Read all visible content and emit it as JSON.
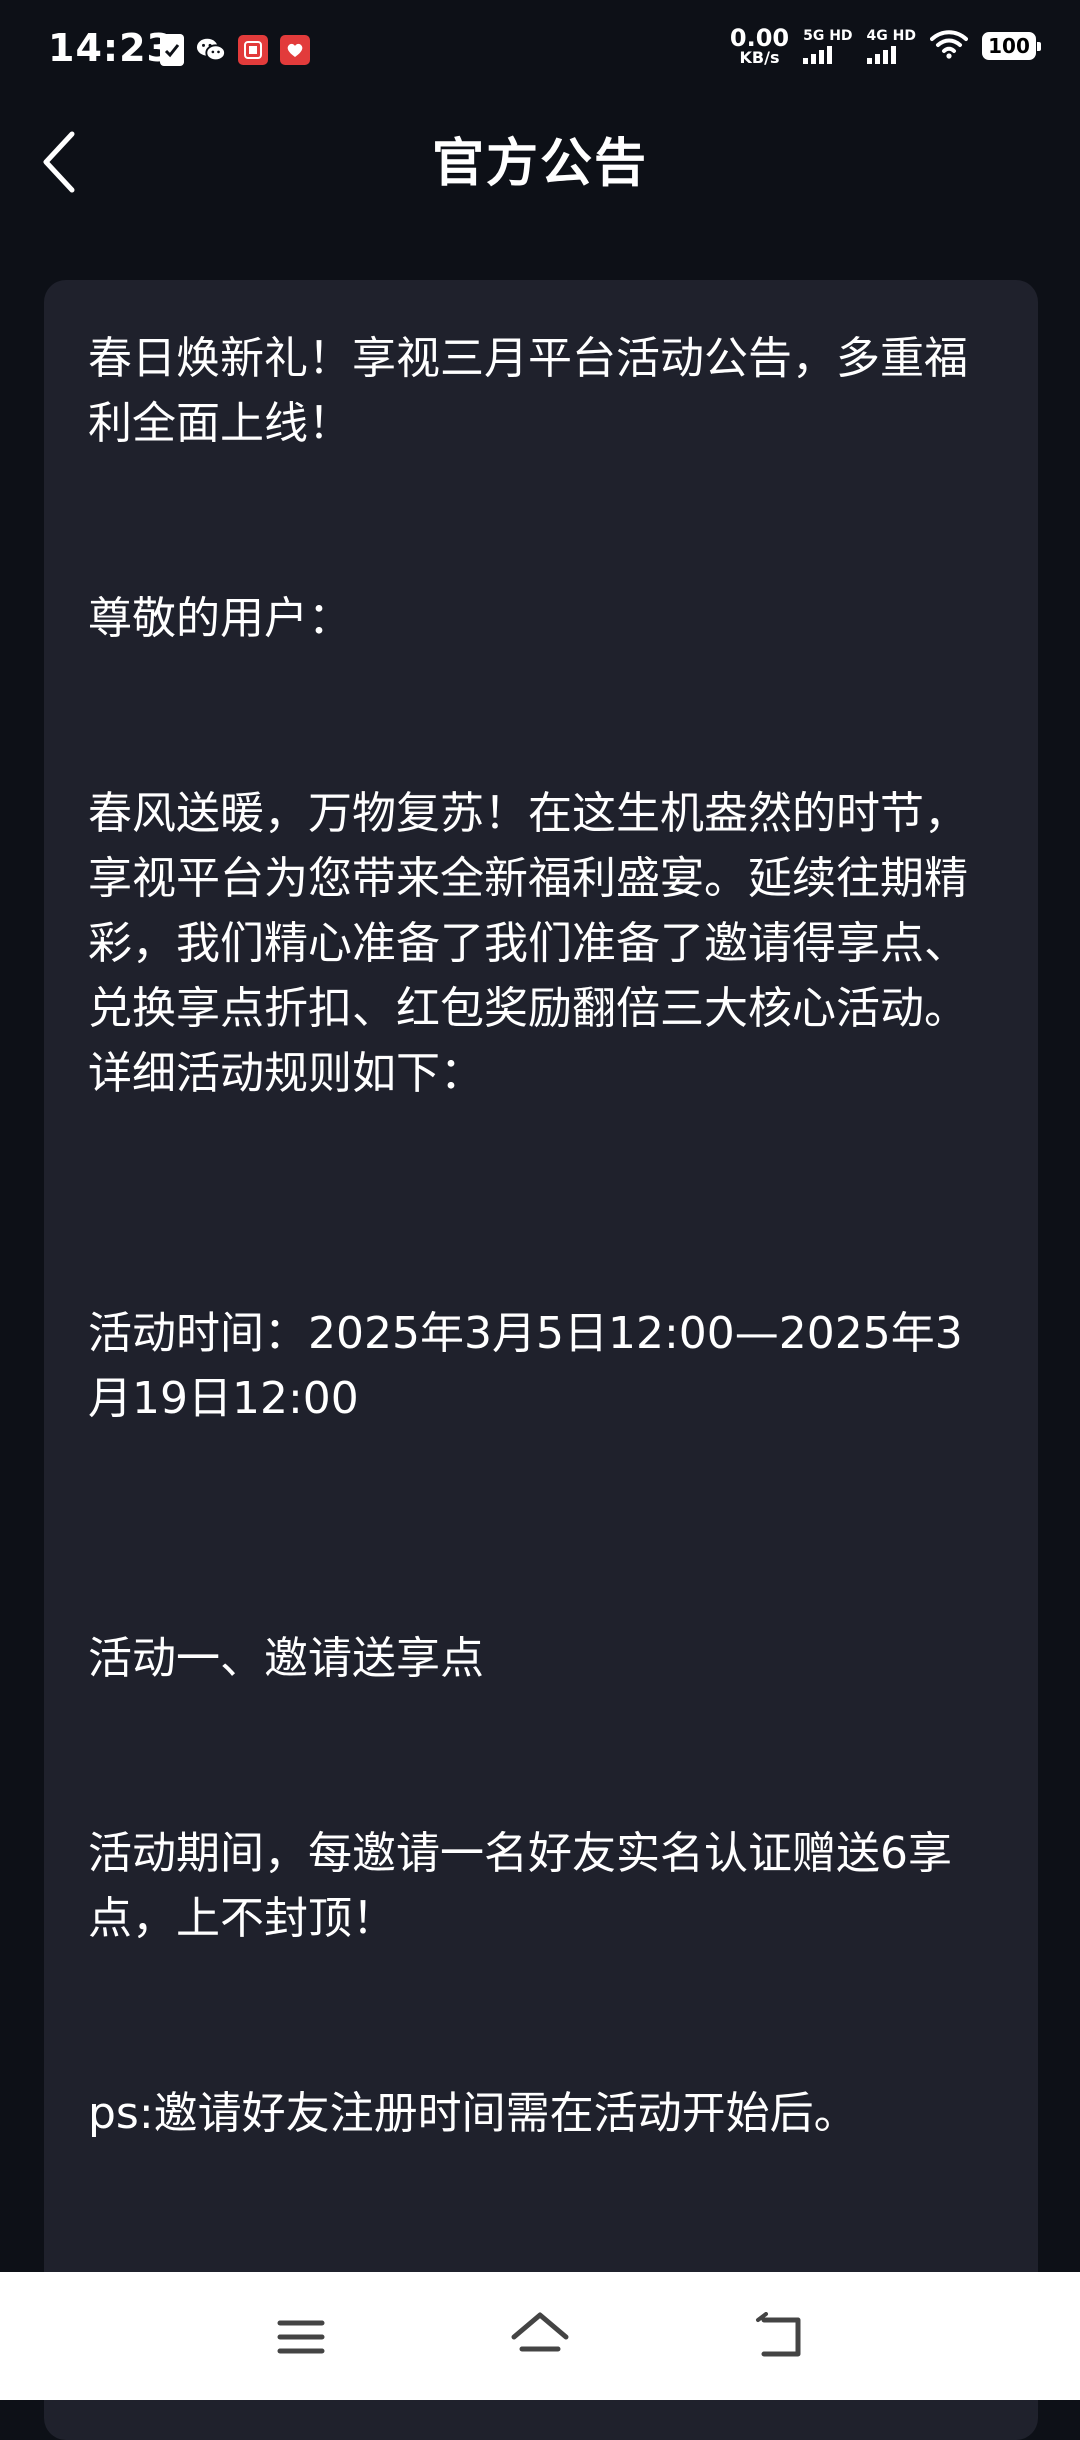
{
  "status_bar": {
    "time": "14:23",
    "net_speed_value": "0.00",
    "net_speed_unit": "KB/s",
    "sim1_label": "5G HD",
    "sim2_label": "4G HD",
    "battery": "100",
    "icons": [
      "sim-card-icon",
      "wechat-icon",
      "app-notification-icon",
      "app-notification-icon-2",
      "wifi-icon"
    ]
  },
  "header": {
    "title": "官方公告",
    "back_icon": "chevron-left-icon"
  },
  "announcement": {
    "title": "春日焕新礼！享视三月平台活动公告，多重福利全面上线！",
    "greeting": "尊敬的用户：",
    "intro": "春风送暖，万物复苏！在这生机盎然的时节，享视平台为您带来全新福利盛宴。延续往期精彩，我们精心准备了我们准备了邀请得享点、兑换享点折扣、红包奖励翻倍三大核心活动。详细活动规则如下：",
    "time": "活动时间：2025年3月5日12:00—2025年3月19日12:00",
    "activity1_title": "活动一、邀请送享点",
    "activity1_desc": "活动期间，每邀请一名好友实名认证赠送6享点，上不封顶！",
    "activity1_ps": "ps:邀请好友注册时间需在活动开始后。"
  },
  "nav_bar": {
    "icons": [
      "menu-icon",
      "home-icon",
      "back-icon"
    ]
  },
  "colors": {
    "background": "#0d1017",
    "card": "#1f212c",
    "text": "#ffffff",
    "nav_bar": "#ffffff"
  }
}
